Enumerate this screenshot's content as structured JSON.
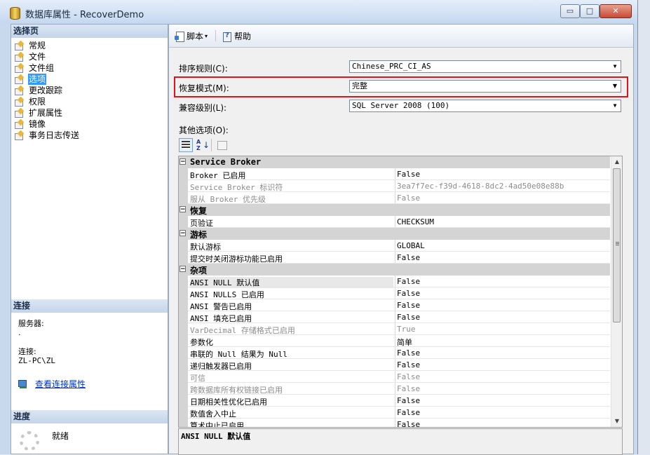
{
  "window": {
    "title": "数据库属性 - RecoverDemo",
    "minimize": "▭",
    "maximize": "□",
    "close": "✕"
  },
  "left": {
    "select_page_header": "选择页",
    "nav_items": [
      "常规",
      "文件",
      "文件组",
      "选项",
      "更改跟踪",
      "权限",
      "扩展属性",
      "镜像",
      "事务日志传送"
    ],
    "selected_nav": "选项",
    "connection_header": "连接",
    "server_label": "服务器:",
    "server_value": ".",
    "connection_label": "连接:",
    "connection_value": "ZL-PC\\ZL",
    "view_connection_props": "查看连接属性",
    "progress_header": "进度",
    "progress_status": "就绪"
  },
  "toolbar": {
    "script_label": "脚本",
    "help_label": "帮助"
  },
  "form": {
    "collation_label": "排序规则(C):",
    "collation_value": "Chinese_PRC_CI_AS",
    "recovery_label": "恢复模式(M):",
    "recovery_value": "完整",
    "compat_label": "兼容级别(L):",
    "compat_value": "SQL Server 2008 (100)",
    "other_options_label": "其他选项(O):"
  },
  "property_grid": {
    "rows": [
      {
        "type": "category",
        "name": "Service Broker"
      },
      {
        "type": "prop",
        "name": "Broker 已启用",
        "value": "False"
      },
      {
        "type": "prop",
        "name": "Service Broker 标识符",
        "value": "3ea7f7ec-f39d-4618-8dc2-4ad50e08e88b",
        "dim": true
      },
      {
        "type": "prop",
        "name": "服从 Broker 优先级",
        "value": "False",
        "dim": true
      },
      {
        "type": "category",
        "name": "恢复"
      },
      {
        "type": "prop",
        "name": "页验证",
        "value": "CHECKSUM"
      },
      {
        "type": "category",
        "name": "游标"
      },
      {
        "type": "prop",
        "name": "默认游标",
        "value": "GLOBAL"
      },
      {
        "type": "prop",
        "name": "提交时关闭游标功能已启用",
        "value": "False"
      },
      {
        "type": "category",
        "name": "杂项"
      },
      {
        "type": "prop",
        "name": "ANSI NULL 默认值",
        "value": "False",
        "selected": true
      },
      {
        "type": "prop",
        "name": "ANSI NULLS 已启用",
        "value": "False"
      },
      {
        "type": "prop",
        "name": "ANSI 警告已启用",
        "value": "False"
      },
      {
        "type": "prop",
        "name": "ANSI 填充已启用",
        "value": "False"
      },
      {
        "type": "prop",
        "name": "VarDecimal 存储格式已启用",
        "value": "True",
        "dim": true
      },
      {
        "type": "prop",
        "name": "参数化",
        "value": "简单"
      },
      {
        "type": "prop",
        "name": "串联的 Null 结果为 Null",
        "value": "False"
      },
      {
        "type": "prop",
        "name": "递归触发器已启用",
        "value": "False"
      },
      {
        "type": "prop",
        "name": "可信",
        "value": "False",
        "dim": true
      },
      {
        "type": "prop",
        "name": "跨数据库所有权链接已启用",
        "value": "False",
        "dim": true
      },
      {
        "type": "prop",
        "name": "日期相关性优化已启用",
        "value": "False"
      },
      {
        "type": "prop",
        "name": "数值舍入中止",
        "value": "False"
      },
      {
        "type": "prop",
        "name": "算术中止已启用",
        "value": "False"
      }
    ]
  },
  "description": {
    "title": "ANSI NULL 默认值"
  },
  "colors": {
    "highlight": "#e0141a",
    "selection": "#3399ff",
    "link": "#0033cc"
  }
}
